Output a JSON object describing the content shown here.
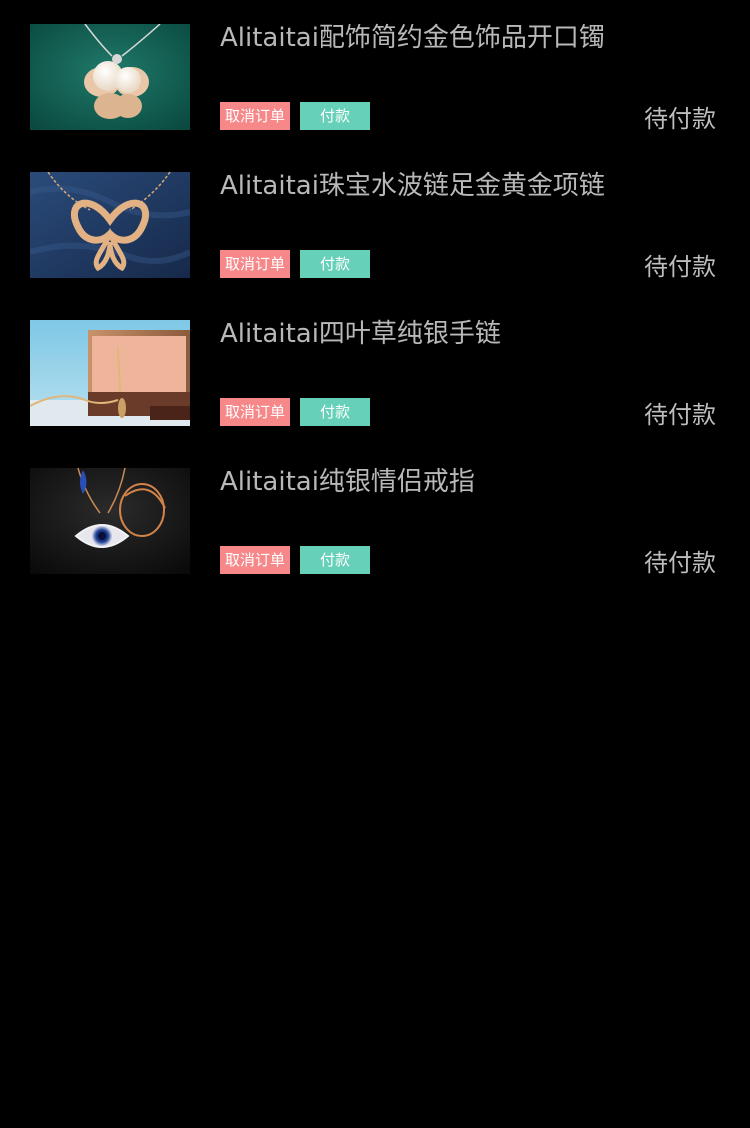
{
  "orders": [
    {
      "title": "Alitaitai配饰简约金色饰品开口镯",
      "cancel_label": "取消订单",
      "pay_label": "付款",
      "status": "待付款",
      "image": "pearl-flower-necklace-on-green-velvet"
    },
    {
      "title": "Alitaitai珠宝水波链足金黄金项链",
      "cancel_label": "取消订单",
      "pay_label": "付款",
      "status": "待付款",
      "image": "gold-butterfly-necklace-on-denim"
    },
    {
      "title": "Alitaitai四叶草纯银手链",
      "cancel_label": "取消订单",
      "pay_label": "付款",
      "status": "待付款",
      "image": "bracelet-on-wooden-drawer-blue-background"
    },
    {
      "title": "Alitaitai纯银情侣戒指",
      "cancel_label": "取消订单",
      "pay_label": "付款",
      "status": "待付款",
      "image": "evil-eye-pendant-on-dark-background"
    }
  ],
  "colors": {
    "background": "#000000",
    "cancel_button": "#f6888a",
    "pay_button": "#66d0b8",
    "title_text": "#b8b8b8",
    "status_text": "#bdbdbd"
  }
}
